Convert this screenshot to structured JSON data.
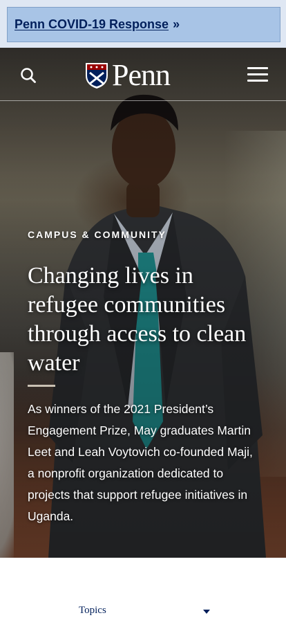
{
  "alert": {
    "link_text": "Penn COVID-19 Response",
    "arrow": "»"
  },
  "header": {
    "logo_text": "Penn",
    "logo_icon": "penn-shield-icon",
    "search_icon": "search-icon",
    "menu_icon": "hamburger-menu-icon"
  },
  "hero": {
    "category": "CAMPUS & COMMUNITY",
    "headline": "Changing lives in refugee communities through access to clean water",
    "summary": "As winners of the 2021 President’s Engagement Prize, May graduates Martin Leet and Leah Voytovich co-founded Maji, a nonprofit organization dedicated to projects that support refugee initiatives in Uganda."
  },
  "filters": {
    "topics_label": "Topics",
    "topics_icon": "caret-down-icon"
  },
  "colors": {
    "penn_blue": "#011f5b",
    "alert_bg": "#a8c4e6",
    "white": "#ffffff"
  }
}
